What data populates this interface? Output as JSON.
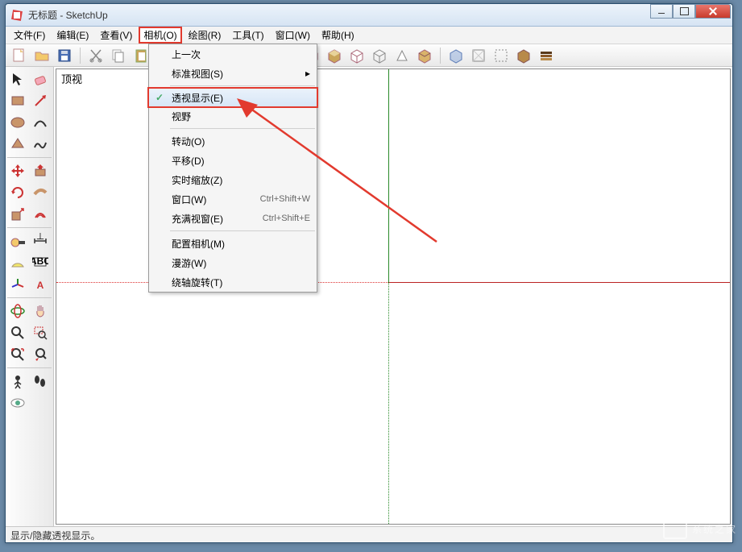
{
  "window": {
    "title": "无标题 - SketchUp"
  },
  "menubar": {
    "items": [
      {
        "label": "文件(F)"
      },
      {
        "label": "编辑(E)"
      },
      {
        "label": "查看(V)"
      },
      {
        "label": "相机(O)",
        "active": true
      },
      {
        "label": "绘图(R)"
      },
      {
        "label": "工具(T)"
      },
      {
        "label": "窗口(W)"
      },
      {
        "label": "帮助(H)"
      }
    ]
  },
  "camera_menu": {
    "items": [
      {
        "label": "上一次"
      },
      {
        "label": "标准视图(S)",
        "submenu": true
      },
      {
        "sep": true
      },
      {
        "label": "透视显示(E)",
        "checked": true,
        "highlight": true
      },
      {
        "label": "视野"
      },
      {
        "sep": true
      },
      {
        "label": "转动(O)"
      },
      {
        "label": "平移(D)"
      },
      {
        "label": "实时缩放(Z)"
      },
      {
        "label": "窗口(W)",
        "shortcut": "Ctrl+Shift+W"
      },
      {
        "label": "充满视窗(E)",
        "shortcut": "Ctrl+Shift+E"
      },
      {
        "sep": true
      },
      {
        "label": "配置相机(M)"
      },
      {
        "label": "漫游(W)"
      },
      {
        "label": "绕轴旋转(T)"
      }
    ]
  },
  "view": {
    "label": "顶视"
  },
  "statusbar": {
    "text": "显示/隐藏透视显示。"
  },
  "watermark": {
    "text": "系统之家"
  }
}
